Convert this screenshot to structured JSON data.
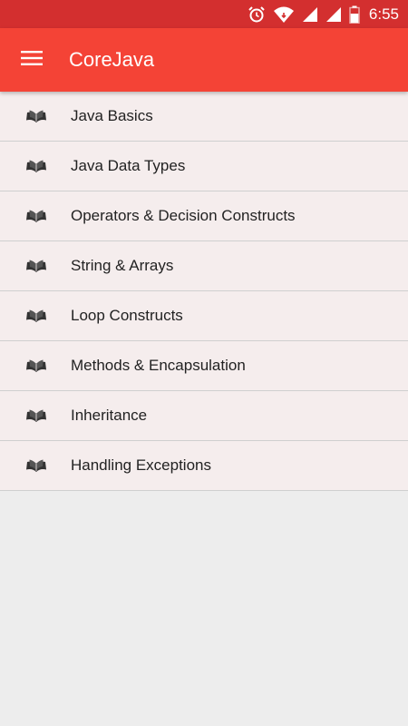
{
  "status_bar": {
    "time": "6:55",
    "icons": [
      "alarm-icon",
      "wifi-icon",
      "signal-icon",
      "signal-icon",
      "battery-icon"
    ],
    "color": "#d32f2f"
  },
  "app_bar": {
    "title": "CoreJava",
    "menu_icon": "hamburger-menu-icon",
    "color": "#f44336"
  },
  "topics": [
    {
      "label": "Java Basics",
      "icon": "book-icon"
    },
    {
      "label": "Java Data Types",
      "icon": "book-icon"
    },
    {
      "label": "Operators & Decision Constructs",
      "icon": "book-icon"
    },
    {
      "label": "String & Arrays",
      "icon": "book-icon"
    },
    {
      "label": "Loop Constructs",
      "icon": "book-icon"
    },
    {
      "label": "Methods & Encapsulation",
      "icon": "book-icon"
    },
    {
      "label": "Inheritance",
      "icon": "book-icon"
    },
    {
      "label": "Handling Exceptions",
      "icon": "book-icon"
    }
  ]
}
